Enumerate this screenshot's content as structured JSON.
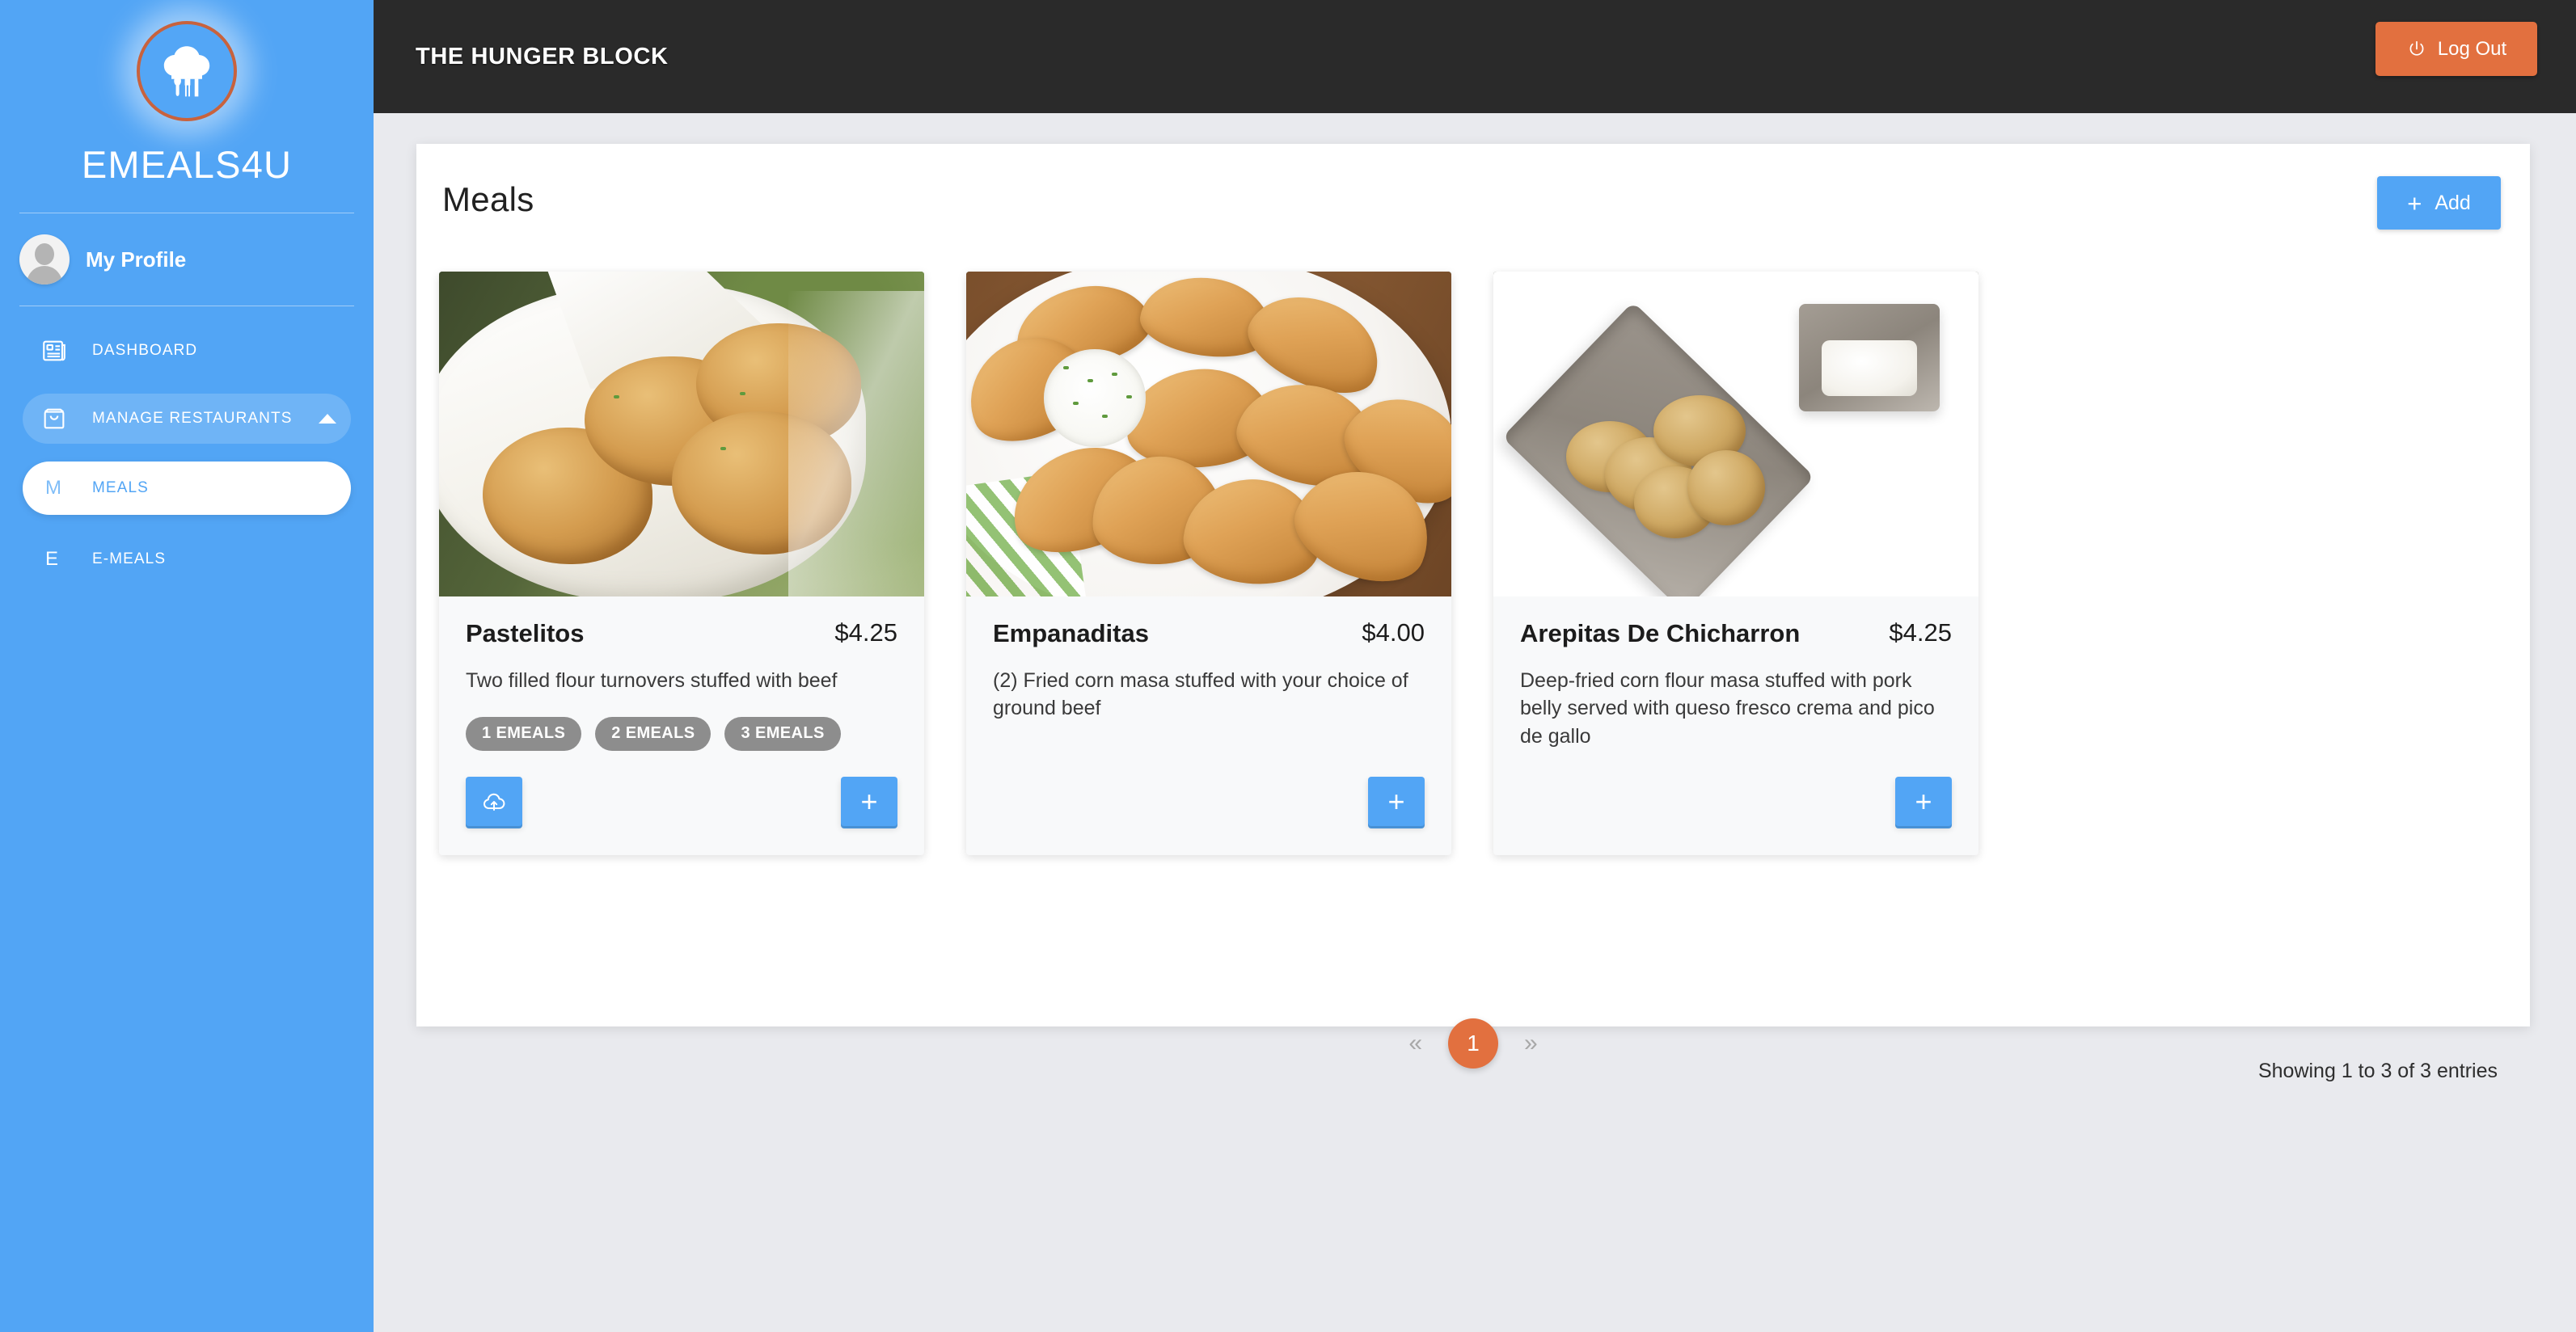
{
  "sidebar": {
    "brand": "EMEALS4U",
    "logo_icon": "chef-hat-utensils-icon",
    "profile": {
      "label": "My Profile",
      "avatar_icon": "user-avatar-icon"
    },
    "nav": [
      {
        "label": "DASHBOARD",
        "icon": "dashboard-icon",
        "active": false
      },
      {
        "label": "MANAGE RESTAURANTS",
        "icon": "shopping-bag-icon",
        "active": false,
        "expanded": true,
        "caret_icon": "chevron-up-icon"
      }
    ],
    "subnav": [
      {
        "mark": "M",
        "label": "MEALS",
        "active": true
      },
      {
        "mark": "E",
        "label": "E-MEALS",
        "active": false
      }
    ]
  },
  "header": {
    "title": "THE HUNGER BLOCK",
    "logout_label": "Log Out",
    "logout_icon": "power-icon"
  },
  "panel": {
    "title": "Meals",
    "add_label": "Add",
    "add_icon": "plus-icon"
  },
  "meals": [
    {
      "name": "Pastelitos",
      "price": "$4.25",
      "description": "Two filled flour turnovers stuffed with beef",
      "badges": [
        "1 EMEALS",
        "2 EMEALS",
        "3 EMEALS"
      ],
      "photo_alt": "fried-pastelitos-in-paper-lined-bowl",
      "upload_icon": "cloud-upload-icon",
      "add_icon": "plus-icon",
      "has_upload": true
    },
    {
      "name": "Empanaditas",
      "price": "$4.00",
      "description": "(2) Fried corn masa stuffed with your choice of ground beef",
      "badges": [],
      "photo_alt": "empanaditas-on-white-plate-with-dip",
      "add_icon": "plus-icon",
      "has_upload": false
    },
    {
      "name": "Arepitas De Chicharron",
      "price": "$4.25",
      "description": "Deep-fried corn flour masa stuffed with pork belly served with queso fresco crema and pico de gallo",
      "badges": [],
      "photo_alt": "arepitas-in-square-metal-dish-with-crema",
      "add_icon": "plus-icon",
      "has_upload": false
    }
  ],
  "pagination": {
    "prev_label": "«",
    "next_label": "»",
    "current_page": "1",
    "entries_text": "Showing 1 to 3 of 3 entries"
  },
  "colors": {
    "sidebar_blue": "#52a5f5",
    "accent_orange": "#e2703f",
    "header_dark": "#2a2a2a",
    "page_bg": "#e9eaee",
    "badge_gray": "#8d8d8d"
  }
}
